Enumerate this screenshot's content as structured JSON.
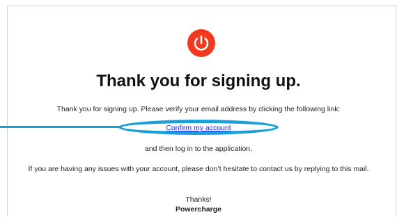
{
  "email": {
    "logo_icon": "power-icon",
    "accent_color": "#f0391f",
    "highlight_color": "#1a9fd8",
    "title": "Thank you for signing up.",
    "intro": "Thank you for signing up. Please verify your email address by clicking the following link:",
    "confirm_link": "Confirm my account",
    "after_link": "and then log in to the application.",
    "help_text": "If you are having any issues with your account, please don’t hesitate to contact us by replying to this mail.",
    "sign_off": "Thanks!",
    "sender": "Powercharge"
  }
}
